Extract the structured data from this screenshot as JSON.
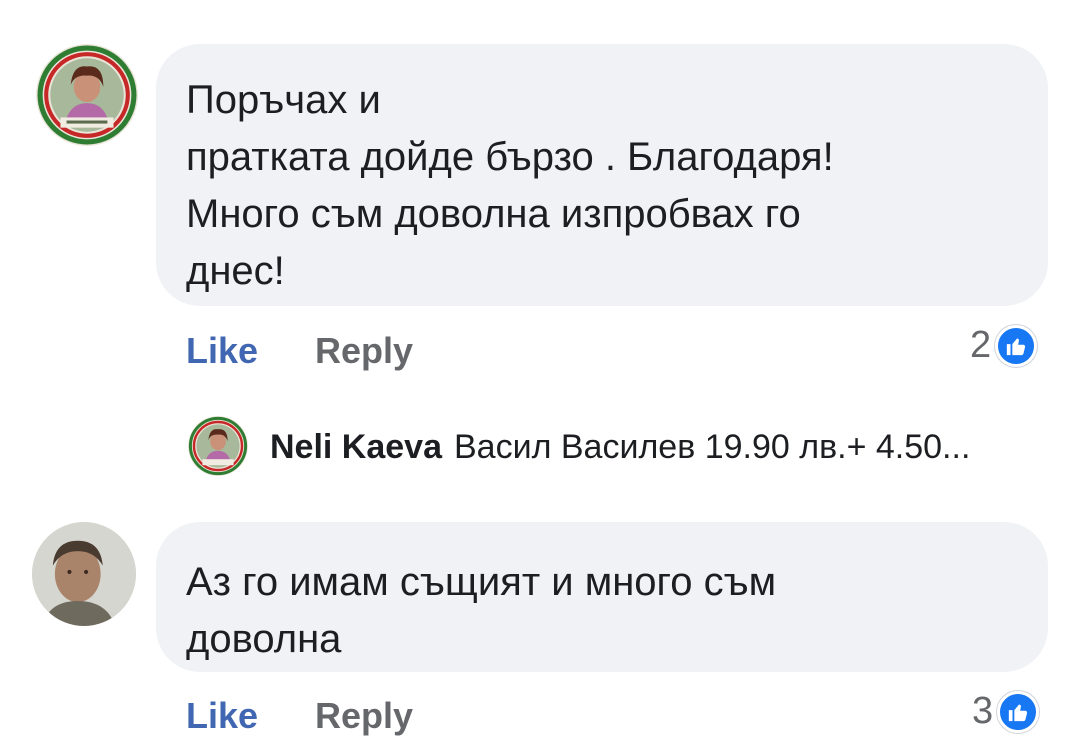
{
  "colors": {
    "like_blue": "#4267b2",
    "badge_blue": "#1877f2",
    "bubble_bg": "#f0f2f5",
    "secondary_text": "#65676b"
  },
  "comments": [
    {
      "text": "Поръчах и\nпратката дойде бързо . Благодаря!\nМного съм доволна изпробвах го\nднес!",
      "like_label": "Like",
      "reply_label": "Reply",
      "reaction_count": "2",
      "reaction_icon": "thumbs-up-icon",
      "reply_preview": {
        "author": "Neli Kaeva",
        "snippet": "Васил Василев 19.90 лв.+ 4.50..."
      }
    },
    {
      "text": "Аз го имам същият  и много съм\nдоволна",
      "like_label": "Like",
      "reply_label": "Reply",
      "reaction_count": "3",
      "reaction_icon": "thumbs-up-icon"
    }
  ]
}
